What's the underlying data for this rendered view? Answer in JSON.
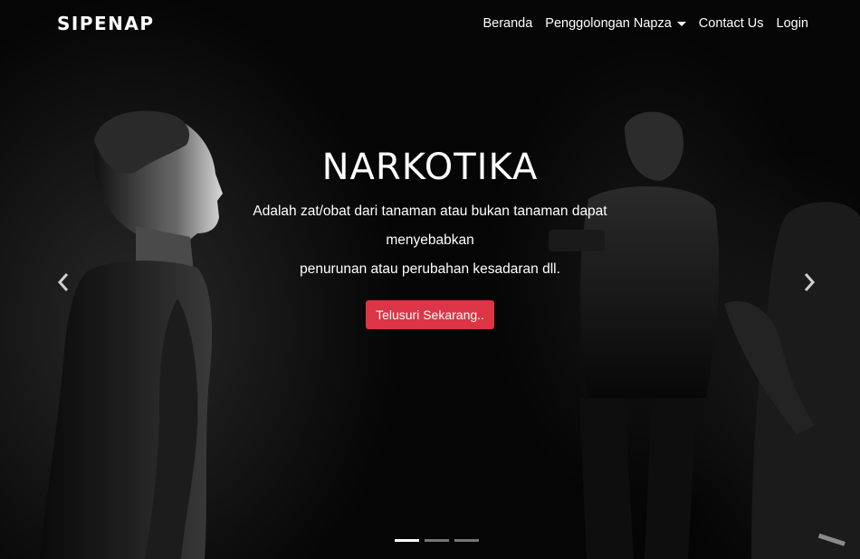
{
  "navbar": {
    "brand": "SIPENAP",
    "items": [
      {
        "label": "Beranda"
      },
      {
        "label": "Penggolongan Napza",
        "dropdown": true
      },
      {
        "label": "Contact Us"
      },
      {
        "label": "Login"
      }
    ]
  },
  "carousel": {
    "slide_count": 3,
    "active_slide": 1,
    "caption": {
      "title": "NARKOTIKA",
      "line1": "Adalah zat/obat dari tanaman atau bukan tanaman dapat",
      "line2": "menyebabkan",
      "line3": "penurunan atau perubahan kesadaran dll.",
      "button": "Telusuri Sekarang.."
    },
    "prev_icon": "chevron-left-icon",
    "next_icon": "chevron-right-icon"
  },
  "colors": {
    "button": "#dc3545",
    "background": "#000000",
    "text": "#ffffff"
  }
}
